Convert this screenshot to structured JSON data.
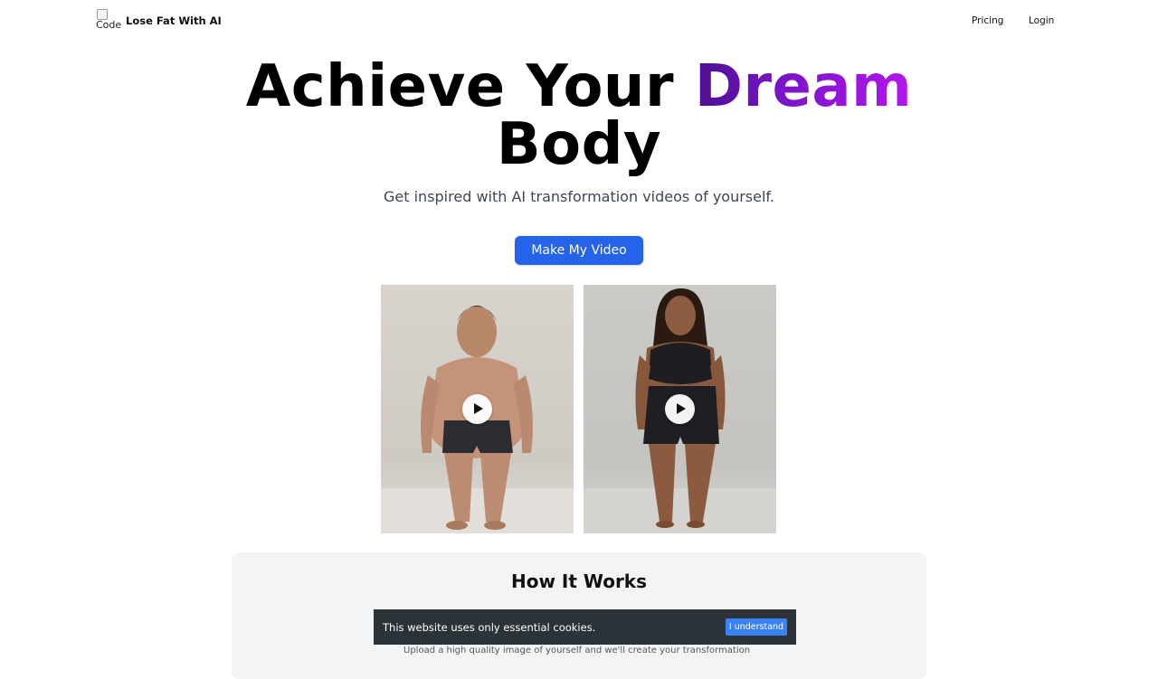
{
  "nav": {
    "logo_alt": "Code",
    "brand": "Lose Fat With AI",
    "links": [
      {
        "label": "Pricing"
      },
      {
        "label": "Login"
      }
    ]
  },
  "hero": {
    "title_prefix": "Achieve Your ",
    "title_highlight": "Dream",
    "title_suffix": "Body",
    "subtitle": "Get inspired with AI transformation videos of yourself.",
    "cta_label": "Make My Video",
    "highlight_gradient": [
      "#4b0f8f",
      "#b514f0"
    ],
    "cta_color": "#2563eb"
  },
  "videos": [
    {
      "icon": "play-icon"
    },
    {
      "icon": "play-icon"
    }
  ],
  "how_it_works": {
    "title": "How It Works",
    "partial_text": "Upload a high quality image of yourself and we'll create your transformation"
  },
  "cookie_banner": {
    "message": "This website uses only essential cookies.",
    "button_label": "I understand"
  }
}
